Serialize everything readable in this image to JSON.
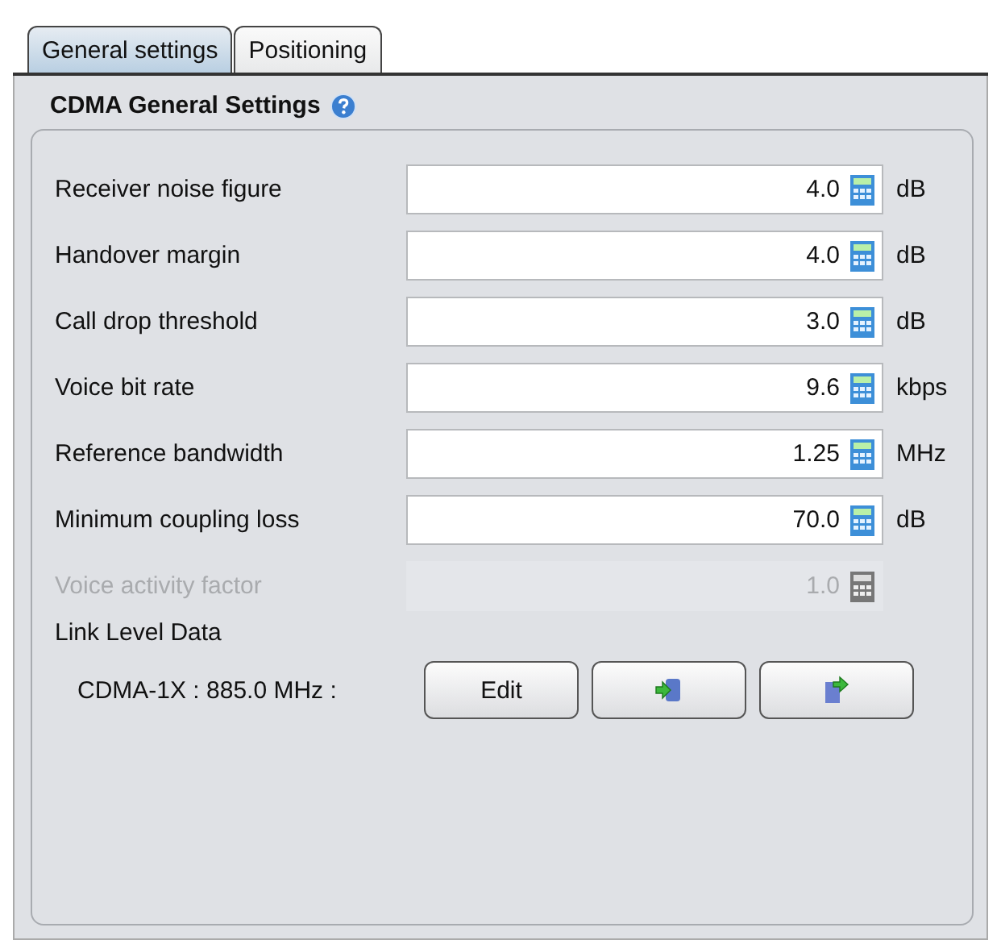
{
  "tabs": [
    {
      "label": "General settings",
      "selected": true
    },
    {
      "label": "Positioning",
      "selected": false
    }
  ],
  "section": {
    "title": "CDMA General Settings"
  },
  "fields": [
    {
      "label": "Receiver noise figure",
      "value": "4.0",
      "unit": "dB",
      "disabled": false
    },
    {
      "label": "Handover margin",
      "value": "4.0",
      "unit": "dB",
      "disabled": false
    },
    {
      "label": "Call drop threshold",
      "value": "3.0",
      "unit": "dB",
      "disabled": false
    },
    {
      "label": "Voice bit rate",
      "value": "9.6",
      "unit": "kbps",
      "disabled": false
    },
    {
      "label": "Reference bandwidth",
      "value": "1.25",
      "unit": "MHz",
      "disabled": false
    },
    {
      "label": "Minimum coupling loss",
      "value": "70.0",
      "unit": "dB",
      "disabled": false
    },
    {
      "label": "Voice activity factor",
      "value": "1.0",
      "disabled": true
    }
  ],
  "link_level": {
    "title": "Link Level Data",
    "label": "CDMA-1X : 885.0 MHz :",
    "buttons": [
      {
        "kind": "text",
        "label": "Edit"
      },
      {
        "kind": "import"
      },
      {
        "kind": "export"
      }
    ]
  }
}
